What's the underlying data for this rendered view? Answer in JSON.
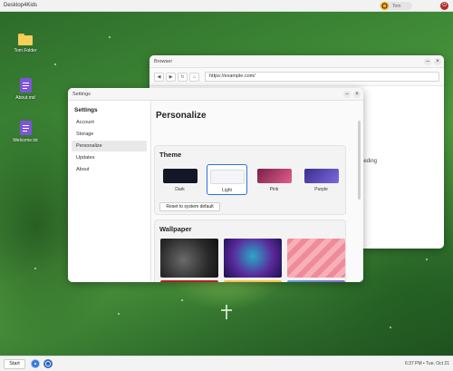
{
  "topbar": {
    "app_title": "Desktop4Kids",
    "user_name": "Tom",
    "power_icon": "⏻"
  },
  "desktop": {
    "icons": [
      {
        "label": "Tom Folder",
        "icon": "folder-icon"
      },
      {
        "label": "About.md",
        "icon": "document-icon"
      },
      {
        "label": "Welcome.txt",
        "icon": "document-icon"
      }
    ]
  },
  "browser": {
    "title": "Browser",
    "minimize": "–",
    "close": "×",
    "back": "◀",
    "forward": "▶",
    "reload": "↻",
    "home": "⌂",
    "url": "https://example.com/",
    "content_text": "eeding"
  },
  "settings": {
    "title": "Settings",
    "minimize": "–",
    "close": "×",
    "sidebar_title": "Settings",
    "sidebar_items": [
      "Account",
      "Storage",
      "Personalize",
      "Updates",
      "About"
    ],
    "active_item": "Personalize",
    "page_title": "Personalize",
    "theme": {
      "heading": "Theme",
      "options": [
        {
          "label": "Dark",
          "color": "#141826"
        },
        {
          "label": "Light",
          "color": "#f4f5f8"
        },
        {
          "label": "Pink",
          "color": "#c0406a"
        },
        {
          "label": "Purple",
          "color": "#6a55d0"
        }
      ],
      "selected": "Light",
      "reset_label": "Reset to system default"
    },
    "wallpaper": {
      "heading": "Wallpaper",
      "count_visible": 6
    }
  },
  "taskbar": {
    "start_label": "Start",
    "clock": "6:37 PM • Tue, Oct 21"
  },
  "colors": {
    "accent": "#2a73d9",
    "power": "#b52a2a",
    "document_icon": "#7c55d8",
    "folder_icon": "#f6cf5a"
  }
}
